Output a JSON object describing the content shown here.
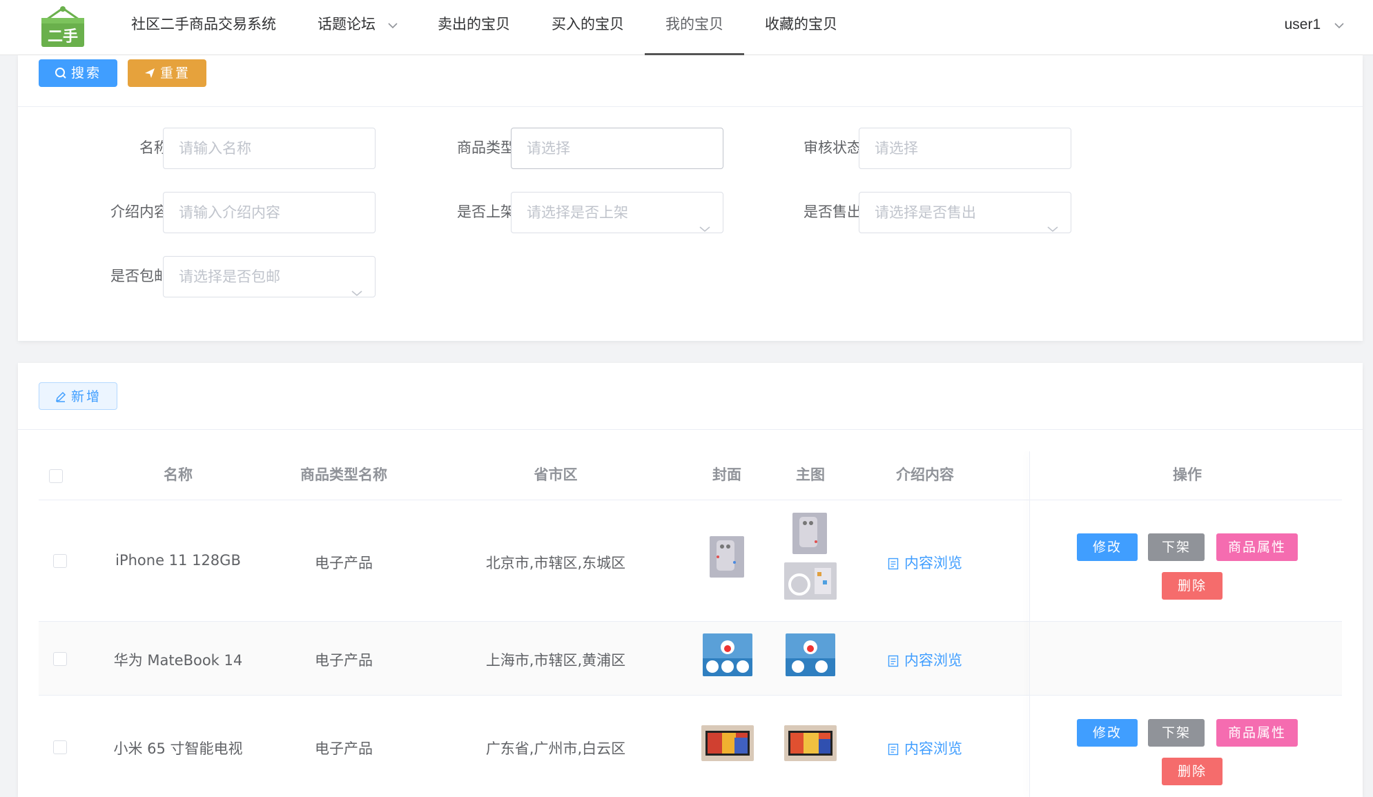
{
  "nav": {
    "logo_text": "二手",
    "items": [
      {
        "label": "社区二手商品交易系统",
        "dropdown": false,
        "active": false
      },
      {
        "label": "话题论坛",
        "dropdown": true,
        "active": false
      },
      {
        "label": "卖出的宝贝",
        "dropdown": false,
        "active": false
      },
      {
        "label": "买入的宝贝",
        "dropdown": false,
        "active": false
      },
      {
        "label": "我的宝贝",
        "dropdown": false,
        "active": true
      },
      {
        "label": "收藏的宝贝",
        "dropdown": false,
        "active": false
      }
    ],
    "user": "user1"
  },
  "search": {
    "search_button": "搜索",
    "reset_button": "重置",
    "fields": {
      "name": {
        "label": "名称",
        "placeholder": "请输入名称"
      },
      "type": {
        "label": "商品类型",
        "placeholder": "请选择"
      },
      "audit": {
        "label": "审核状态",
        "placeholder": "请选择"
      },
      "intro": {
        "label": "介绍内容",
        "placeholder": "请输入介绍内容"
      },
      "onshelf": {
        "label": "是否上架",
        "placeholder": "请选择是否上架"
      },
      "sold": {
        "label": "是否售出",
        "placeholder": "请选择是否售出"
      },
      "shipping": {
        "label": "是否包邮",
        "placeholder": "请选择是否包邮"
      }
    }
  },
  "table": {
    "add_button": "新增",
    "columns": [
      "名称",
      "商品类型名称",
      "省市区",
      "封面",
      "主图",
      "介绍内容",
      "操作"
    ],
    "rows": [
      {
        "name": "iPhone 11 128GB",
        "type": "电子产品",
        "region": "北京市,市辖区,东城区",
        "intro_link": "内容浏览",
        "has_actions": true
      },
      {
        "name": "华为 MateBook 14",
        "type": "电子产品",
        "region": "上海市,市辖区,黄浦区",
        "intro_link": "内容浏览",
        "has_actions": false
      },
      {
        "name": "小米 65 寸智能电视",
        "type": "电子产品",
        "region": "广东省,广州市,白云区",
        "intro_link": "内容浏览",
        "has_actions": true
      }
    ],
    "actions": {
      "edit": "修改",
      "offshelf": "下架",
      "attrs": "商品属性",
      "delete": "删除"
    }
  },
  "colors": {
    "primary": "#409eff",
    "warning": "#e6a23c",
    "info": "#909399",
    "pink": "#f56cb0",
    "danger": "#f56c6c",
    "logo_green": "#6ab04c"
  }
}
